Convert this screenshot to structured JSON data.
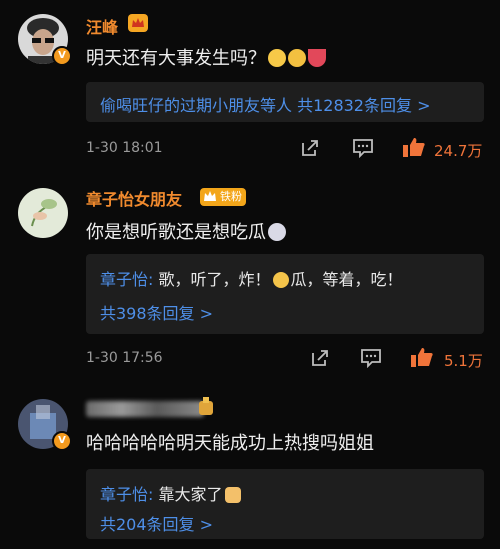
{
  "comments": [
    {
      "username": "汪峰",
      "verified_badge": "V",
      "text": "明天还有大事发生吗？",
      "reply_summary": "偷喝旺仔的过期小朋友等人 共12832条回复 >",
      "time": "1-30 18:01",
      "likes": "24.7万"
    },
    {
      "username": "章子怡女朋友",
      "fan_badge": "铁粉",
      "text": "你是想听歌还是想吃瓜",
      "reply_author": "章子怡:",
      "reply_text": " 歌，听了，炸！",
      "reply_text2": "瓜，等着，吃！",
      "reply_count": "共398条回复 >",
      "time": "1-30 17:56",
      "likes": "5.1万"
    },
    {
      "verified_badge": "V",
      "text": "哈哈哈哈哈明天能成功上热搜吗姐姐",
      "reply_author": "章子怡:",
      "reply_text": " 靠大家了",
      "reply_count": "共204条回复 >"
    }
  ],
  "icons": [
    "crown-icon",
    "share-icon",
    "comment-icon",
    "like-icon"
  ],
  "colors": {
    "username": "#f08a2e",
    "link": "#4e8fe8",
    "like": "#f0743a",
    "reply_bg": "#1e1e1e"
  }
}
